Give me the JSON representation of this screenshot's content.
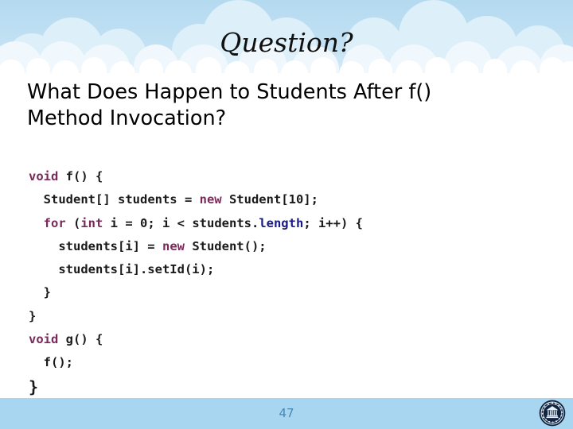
{
  "slide": {
    "title": "Question?",
    "bullet": {
      "line1": "What Does Happen to Students After f()",
      "line2": "Method Invocation?"
    },
    "code": [
      {
        "indent": "",
        "segments": [
          {
            "t": "void",
            "c": "kw"
          },
          {
            "t": " f() {",
            "c": ""
          }
        ]
      },
      {
        "indent": "  ",
        "segments": [
          {
            "t": "Student[] students = ",
            "c": ""
          },
          {
            "t": "new",
            "c": "kw"
          },
          {
            "t": " Student[10];",
            "c": ""
          }
        ]
      },
      {
        "indent": "  ",
        "segments": [
          {
            "t": "for",
            "c": "kw"
          },
          {
            "t": " (",
            "c": ""
          },
          {
            "t": "int",
            "c": "kw"
          },
          {
            "t": " i = 0; i < students.",
            "c": ""
          },
          {
            "t": "length",
            "c": "fld"
          },
          {
            "t": "; i++) {",
            "c": ""
          }
        ]
      },
      {
        "indent": "    ",
        "segments": [
          {
            "t": "students[i] = ",
            "c": ""
          },
          {
            "t": "new",
            "c": "kw"
          },
          {
            "t": " Student();",
            "c": ""
          }
        ]
      },
      {
        "indent": "    ",
        "segments": [
          {
            "t": "students[i].setId(i);",
            "c": ""
          }
        ]
      },
      {
        "indent": "  ",
        "segments": [
          {
            "t": "}",
            "c": ""
          }
        ]
      },
      {
        "indent": "",
        "segments": [
          {
            "t": "}",
            "c": ""
          }
        ]
      },
      {
        "indent": "",
        "segments": [
          {
            "t": "void",
            "c": "kw"
          },
          {
            "t": " g() {",
            "c": ""
          }
        ]
      },
      {
        "indent": "  ",
        "segments": [
          {
            "t": "f();",
            "c": ""
          }
        ]
      },
      {
        "indent": "",
        "big": true,
        "segments": [
          {
            "t": "}",
            "c": ""
          }
        ]
      }
    ],
    "footer": {
      "page_number": "47",
      "logo_name": "university-seal-logo"
    },
    "colors": {
      "sky_top": "#b4daf0",
      "sky_bottom": "#d8ecf8",
      "cloud": "#ffffff",
      "footer_band": "#a8d5ef",
      "page_number_text": "#4a88b8",
      "keyword": "#7a2a58",
      "field": "#191984",
      "code_text": "#1a1a1a",
      "logo": "#10243f"
    }
  }
}
